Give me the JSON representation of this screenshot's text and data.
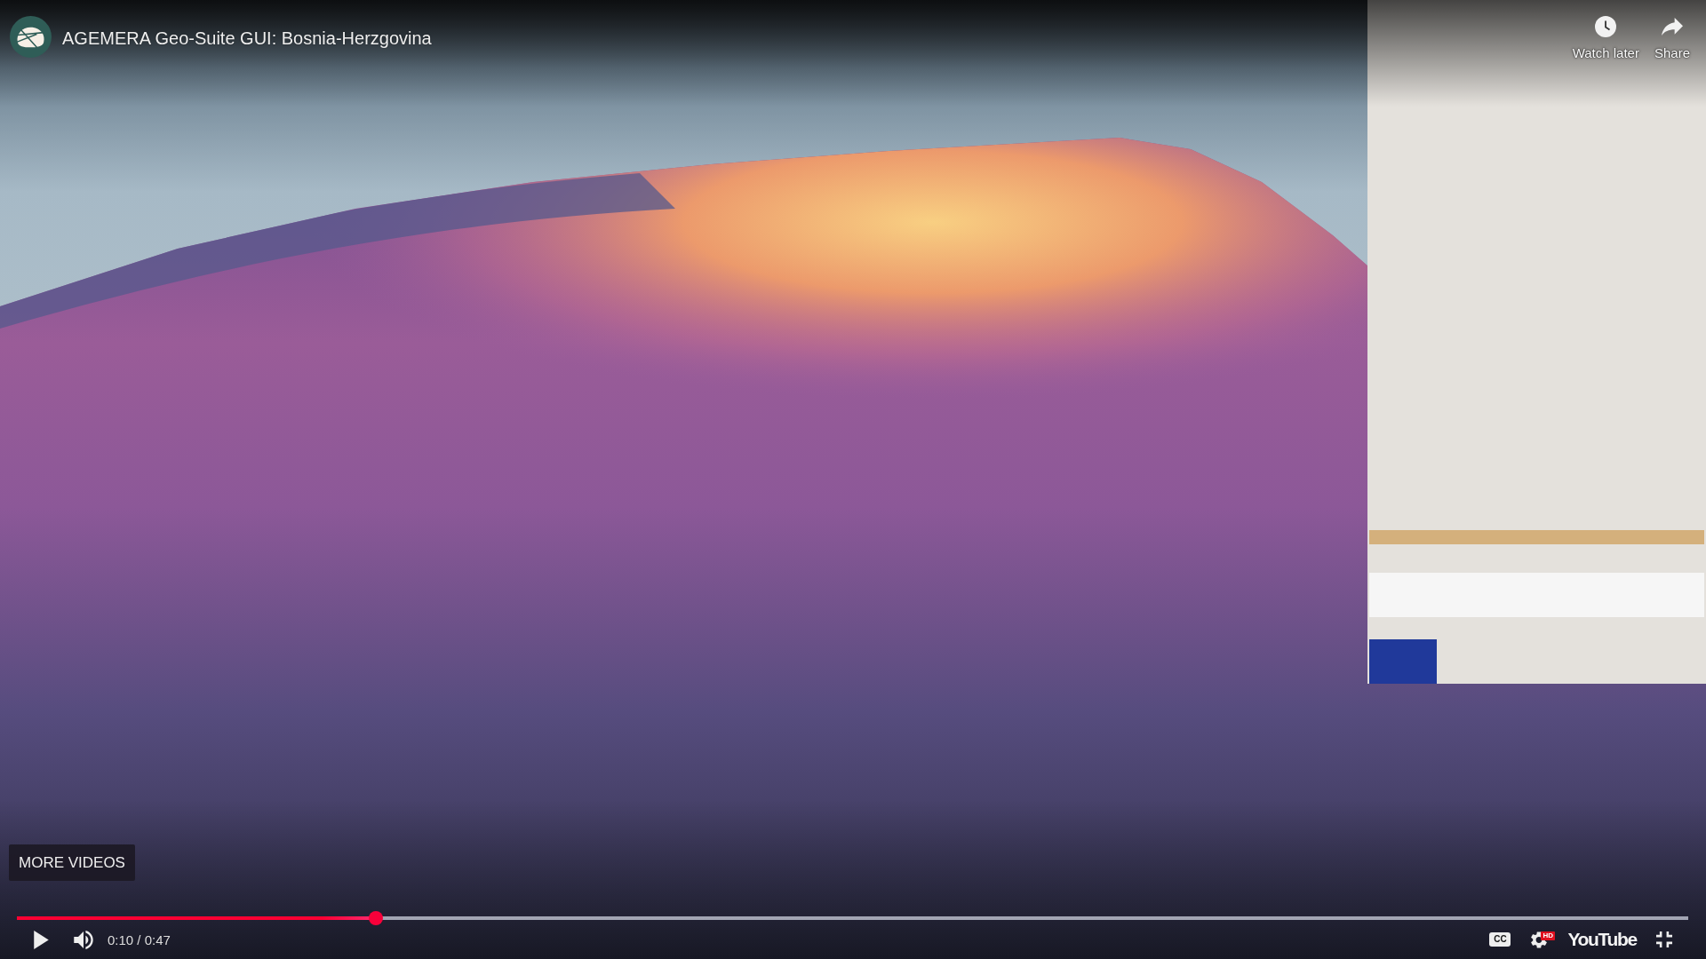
{
  "title_bar": {
    "title": "AGEMERA Geo-Suite GUI: Bosnia-Herzgovina"
  },
  "top_actions": [
    {
      "kind": "watch_later",
      "label": "Watch later"
    },
    {
      "kind": "share",
      "label": "Share"
    }
  ],
  "more_videos_button": {
    "label": "MORE VIDEOS"
  },
  "progress": {
    "level": 0.215
  },
  "left_controls": [
    {
      "kind": "play"
    },
    {
      "kind": "volume"
    },
    {
      "kind": "time",
      "label": "0:10 / 0:47"
    }
  ],
  "right_controls": [
    {
      "kind": "captions",
      "label": "CC",
      "on": false
    },
    {
      "kind": "settings",
      "badge": "HD"
    },
    {
      "kind": "logo",
      "label": "YouTube"
    },
    {
      "kind": "exit_fullscreen"
    }
  ]
}
